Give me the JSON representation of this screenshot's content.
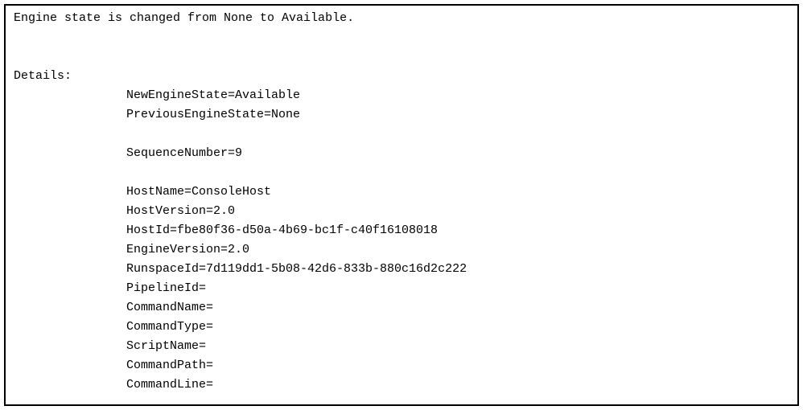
{
  "log": {
    "summary": "Engine state is changed from None to Available.",
    "details_label": "Details:",
    "lines": {
      "l0": "NewEngineState=Available",
      "l1": "PreviousEngineState=None",
      "l2": "SequenceNumber=9",
      "l3": "HostName=ConsoleHost",
      "l4": "HostVersion=2.0",
      "l5": "HostId=fbe80f36-d50a-4b69-bc1f-c40f16108018",
      "l6": "EngineVersion=2.0",
      "l7": "RunspaceId=7d119dd1-5b08-42d6-833b-880c16d2c222",
      "l8": "PipelineId=",
      "l9": "CommandName=",
      "l10": "CommandType=",
      "l11": "ScriptName=",
      "l12": "CommandPath=",
      "l13": "CommandLine="
    }
  }
}
